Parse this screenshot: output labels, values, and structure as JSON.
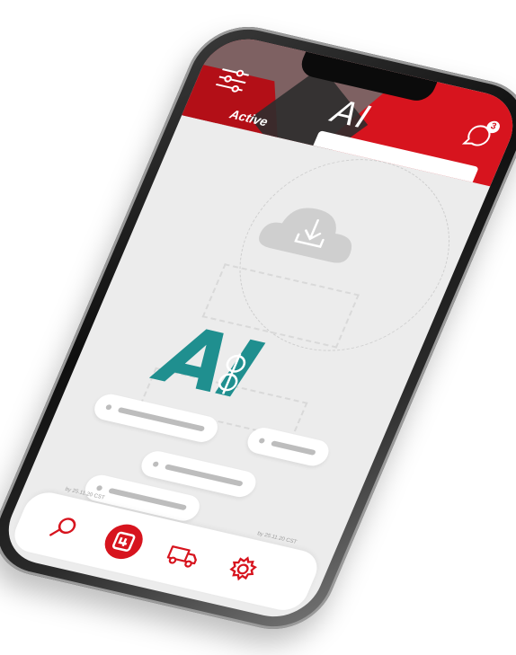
{
  "header": {
    "title": "AI",
    "filter_icon": "sliders-icon",
    "chat_icon": "chat-bubble-icon",
    "chat_badge": "3",
    "tabs": [
      {
        "label": "Active",
        "selected": true
      }
    ]
  },
  "main": {
    "illustration": "cloud-download-icon",
    "logo_text": "AI"
  },
  "footer": {
    "left_text": "by 25.11.20 CST",
    "right_text": "by 25.11.20 CST"
  },
  "bottom_nav": {
    "items": [
      {
        "icon": "search-icon"
      },
      {
        "icon": "package-icon",
        "active": true
      },
      {
        "icon": "truck-icon"
      },
      {
        "icon": "gear-icon"
      }
    ]
  },
  "colors": {
    "brand_red": "#d7141e",
    "accent_teal": "#1f8f8f",
    "screen_bg": "#ececec"
  }
}
